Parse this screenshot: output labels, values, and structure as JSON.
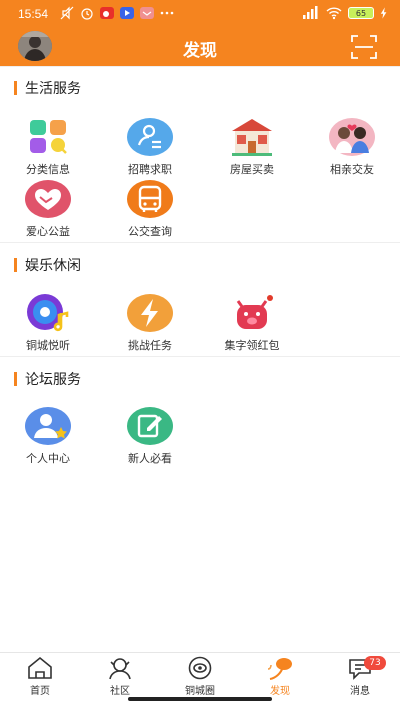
{
  "status_bar": {
    "time": "15:54",
    "battery": "65"
  },
  "header": {
    "title": "发现"
  },
  "sections": [
    {
      "title": "生活服务",
      "items": [
        {
          "label": "分类信息",
          "icon": "category-icon"
        },
        {
          "label": "招聘求职",
          "icon": "job-icon"
        },
        {
          "label": "房屋买卖",
          "icon": "house-icon"
        },
        {
          "label": "相亲交友",
          "icon": "dating-icon"
        },
        {
          "label": "爱心公益",
          "icon": "charity-icon"
        },
        {
          "label": "公交查询",
          "icon": "bus-icon"
        }
      ]
    },
    {
      "title": "娱乐休闲",
      "items": [
        {
          "label": "铜城悦听",
          "icon": "music-disc-icon"
        },
        {
          "label": "挑战任务",
          "icon": "lightning-icon"
        },
        {
          "label": "集字领红包",
          "icon": "piggy-icon"
        }
      ]
    },
    {
      "title": "论坛服务",
      "items": [
        {
          "label": "个人中心",
          "icon": "user-center-icon"
        },
        {
          "label": "新人必看",
          "icon": "edit-icon"
        }
      ]
    }
  ],
  "tabbar": {
    "tabs": [
      {
        "label": "首页"
      },
      {
        "label": "社区"
      },
      {
        "label": "铜城圈"
      },
      {
        "label": "发现"
      },
      {
        "label": "消息",
        "badge": "73"
      }
    ]
  },
  "colors": {
    "brand": "#f5841f",
    "badge": "#f04a3c"
  }
}
